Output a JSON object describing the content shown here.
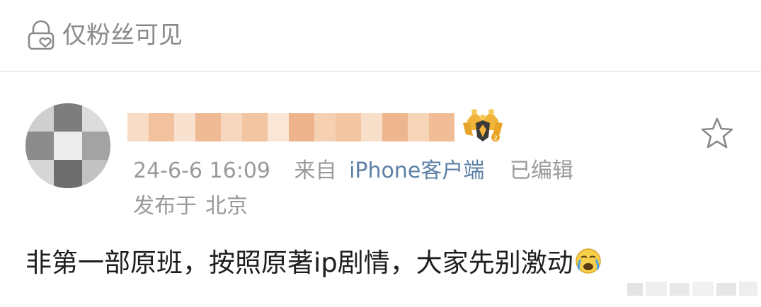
{
  "visibility": {
    "icon": "lock-heart-icon",
    "label": "仅粉丝可见"
  },
  "post": {
    "avatar_icon": "blurred-avatar",
    "username_icon": "blurred-username",
    "badge_icon": "crown-badge-icon",
    "favorite_icon": "star-outline-icon",
    "meta": {
      "time": "24-6-6 16:09",
      "from_prefix": "来自",
      "client": "iPhone客户端",
      "edited": "已编辑"
    },
    "location": {
      "prefix": "发布于",
      "value": "北京"
    },
    "body": "非第一部原班，按照原著ip剧情，大家先别激动",
    "emoji_icon": "crying-face-emoji-icon",
    "watermark_icon": "blurred-watermark"
  },
  "colors": {
    "meta_gray": "#9a9a9a",
    "client_link": "#5d7fa6",
    "badge_gold": "#f0b43a",
    "username_blur": "#f3c8a4"
  }
}
